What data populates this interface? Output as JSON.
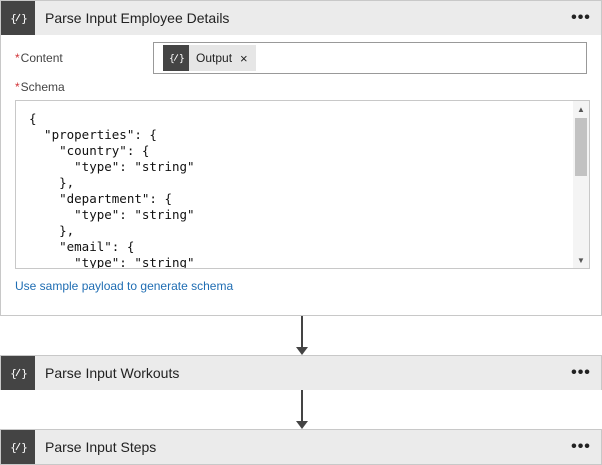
{
  "steps": [
    {
      "title": "Parse Input Employee Details",
      "more": "•••",
      "content": {
        "label": "Content",
        "required_mark": "*",
        "token": {
          "label": "Output",
          "remove": "×",
          "icon": "braces-variable-icon"
        }
      },
      "schema": {
        "label": "Schema",
        "required_mark": "*",
        "text": "{\n  \"properties\": {\n    \"country\": {\n      \"type\": \"string\"\n    },\n    \"department\": {\n      \"type\": \"string\"\n    },\n    \"email\": {\n      \"type\": \"string\""
      },
      "sample_link": "Use sample payload to generate schema",
      "icon": "braces-variable-icon"
    },
    {
      "title": "Parse Input Workouts",
      "more": "•••",
      "icon": "braces-variable-icon"
    },
    {
      "title": "Parse Input Steps",
      "more": "•••",
      "icon": "braces-variable-icon"
    }
  ],
  "colors": {
    "header_bg": "#ebebeb",
    "icon_bg": "#444444",
    "link": "#1f6db3",
    "required": "#d13438"
  }
}
